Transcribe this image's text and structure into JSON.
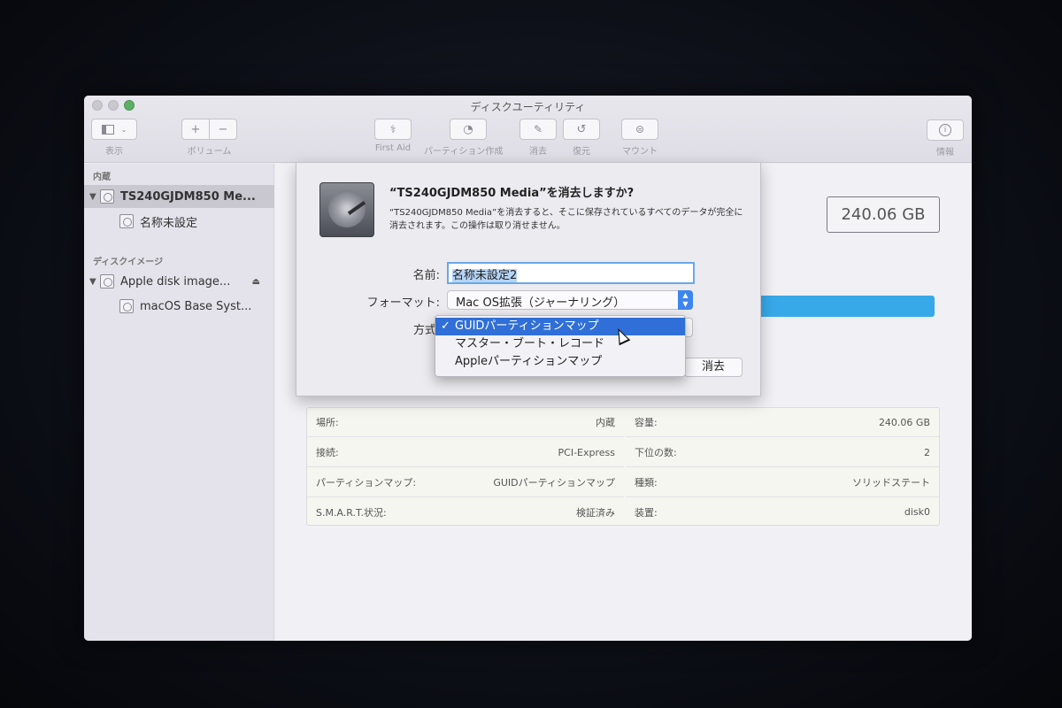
{
  "window": {
    "title": "ディスクユーティリティ"
  },
  "toolbar": {
    "view_label": "表示",
    "volume_label": "ボリューム",
    "volume_add": "+",
    "volume_remove": "−",
    "first_aid_label": "First Aid",
    "partition_label": "パーティション作成",
    "erase_label": "消去",
    "restore_label": "復元",
    "mount_label": "マウント",
    "info_label": "情報"
  },
  "sidebar": {
    "section_internal": "内蔵",
    "section_disk_images": "ディスクイメージ",
    "items": [
      {
        "label": "TS240GJDM850 Me...",
        "selected": true
      },
      {
        "label": "名称未設定"
      },
      {
        "label": "Apple disk image..."
      },
      {
        "label": "macOS Base Syst..."
      }
    ]
  },
  "main": {
    "capacity_box": "240.06 GB"
  },
  "sheet": {
    "title": "“TS240GJDM850 Media”を消去しますか?",
    "description": "“TS240GJDM850 Media”を消去すると、そこに保存されているすべてのデータが完全に消去されます。この操作は取り消せません。",
    "name_label": "名前:",
    "name_value": "名称未設定2",
    "format_label": "フォーマット:",
    "format_value": "Mac OS拡張（ジャーナリング）",
    "scheme_label": "方式",
    "erase_button": "消去"
  },
  "scheme_menu": {
    "options": [
      {
        "label": "GUIDパーティションマップ",
        "checked": true,
        "check": "✓"
      },
      {
        "label": "マスター・ブート・レコード"
      },
      {
        "label": "Appleパーティションマップ"
      }
    ]
  },
  "info": {
    "left": [
      {
        "key": "場所:",
        "value": "内蔵"
      },
      {
        "key": "接続:",
        "value": "PCI-Express"
      },
      {
        "key": "パーティションマップ:",
        "value": "GUIDパーティションマップ"
      },
      {
        "key": "S.M.A.R.T.状況:",
        "value": "検証済み"
      }
    ],
    "right": [
      {
        "key": "容量:",
        "value": "240.06 GB"
      },
      {
        "key": "下位の数:",
        "value": "2"
      },
      {
        "key": "種類:",
        "value": "ソリッドステート"
      },
      {
        "key": "装置:",
        "value": "disk0"
      }
    ]
  },
  "colors": {
    "accent": "#2f6fd7",
    "usage_bar": "#37a9e9",
    "zoom_button": "#5fae66"
  }
}
